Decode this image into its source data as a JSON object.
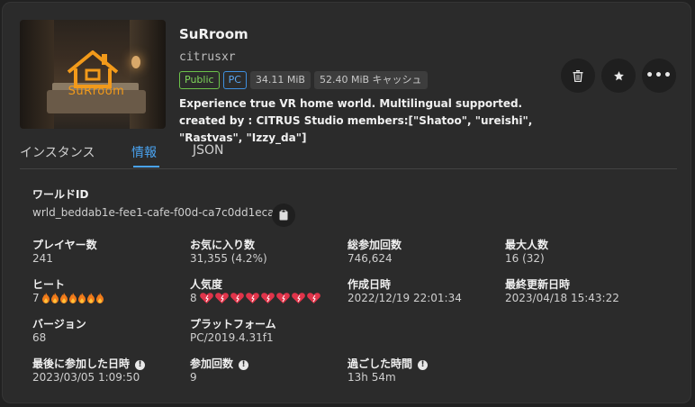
{
  "world": {
    "title": "SuRroom",
    "author": "citrusxr",
    "badges": [
      "Public",
      "PC",
      "34.11 MiB",
      "52.40 MiB キャッシュ"
    ],
    "description": "Experience true VR home world. Multilingual supported. created by : CITRUS Studio members:[\"Shatoo\", \"ureishi\", \"Rastvas\", \"Izzy_da\"]",
    "thumbnail_logo_text": "SuRroom"
  },
  "actions": {
    "delete_icon": "trash-icon",
    "favorite_icon": "star-icon",
    "more_icon": "more-icon"
  },
  "tabs": [
    "インスタンス",
    "情報",
    "JSON"
  ],
  "active_tab": "情報",
  "info": {
    "world_id_label": "ワールドID",
    "world_id": "wrld_beddab1e-fee1-cafe-f00d-ca7c0dd1eca7",
    "players_label": "プレイヤー数",
    "players": "241",
    "favorites_label": "お気に入り数",
    "favorites": "31,355 (4.2%)",
    "visits_label": "総参加回数",
    "visits": "746,624",
    "capacity_label": "最大人数",
    "capacity": "16 (32)",
    "heat_label": "ヒート",
    "heat": "7",
    "heat_count": 7,
    "popularity_label": "人気度",
    "popularity": "8",
    "popularity_count": 8,
    "created_label": "作成日時",
    "created": "2022/12/19 22:01:34",
    "updated_label": "最終更新日時",
    "updated": "2023/04/18 15:43:22",
    "version_label": "バージョン",
    "version": "68",
    "platform_label": "プラットフォーム",
    "platform": "PC/2019.4.31f1",
    "last_visit_label": "最後に参加した日時",
    "last_visit": "2023/03/05 1:09:50",
    "visit_count_label": "参加回数",
    "visit_count": "9",
    "time_spent_label": "過ごした時間",
    "time_spent": "13h 54m"
  },
  "colors": {
    "accent": "#4aa3f0",
    "public_badge": "#6cc24a",
    "pc_badge": "#3f8fe0",
    "heat_icon": "#f07a1a",
    "heart_icon": "#e0344a"
  }
}
